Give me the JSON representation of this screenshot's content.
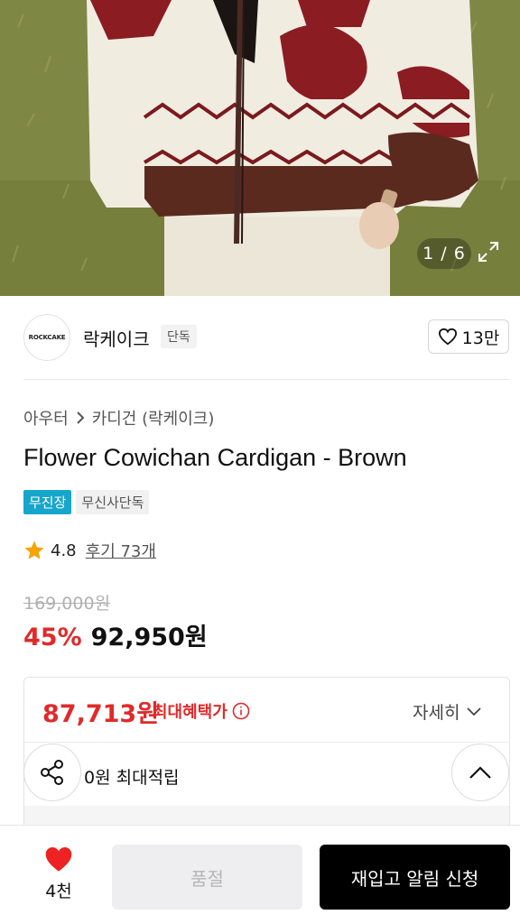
{
  "gallery": {
    "counter": "1 / 6"
  },
  "brand": {
    "logo_text": "ROCKCAKE",
    "name": "락케이크",
    "tag": "단독",
    "like_count": "13만"
  },
  "breadcrumb": {
    "category": "아우터",
    "subcategory": "카디건 (락케이크)"
  },
  "product": {
    "title": "Flower Cowichan Cardigan - Brown",
    "badges": [
      "무진장",
      "무신사단독"
    ],
    "rating": "4.8",
    "reviews": "후기 73개",
    "original_price": "169,000원",
    "discount": "45%",
    "sale_price": "92,950원"
  },
  "benefit": {
    "max_price": "87,713원",
    "max_label": "최대혜택가",
    "detail_label": "자세히",
    "points": "0원 최대적립"
  },
  "bottom_bar": {
    "wish_count": "4천",
    "soldout_label": "품절",
    "restock_label": "재입고 알림 신청"
  },
  "colors": {
    "accent_red": "#e02a2a",
    "badge_blue": "#16a6cc",
    "star": "#f5a400",
    "sweater_red": "#8b1c22",
    "sweater_brown": "#5a2a1e"
  }
}
